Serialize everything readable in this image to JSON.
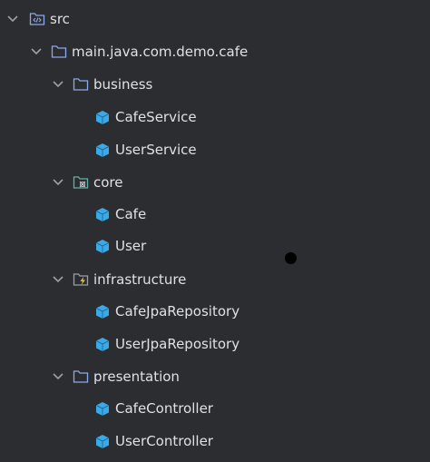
{
  "tree": {
    "src": {
      "label": "src",
      "icon": "source-root-icon"
    },
    "package": {
      "label": "main.java.com.demo.cafe",
      "icon": "package-folder-icon"
    },
    "business": {
      "label": "business",
      "icon": "folder-icon",
      "children": [
        {
          "label": "CafeService"
        },
        {
          "label": "UserService"
        }
      ]
    },
    "core": {
      "label": "core",
      "icon": "folder-core-icon",
      "children": [
        {
          "label": "Cafe"
        },
        {
          "label": "User"
        }
      ]
    },
    "infrastructure": {
      "label": "infrastructure",
      "icon": "folder-infrastructure-icon",
      "children": [
        {
          "label": "CafeJpaRepository"
        },
        {
          "label": "UserJpaRepository"
        }
      ]
    },
    "presentation": {
      "label": "presentation",
      "icon": "folder-icon",
      "children": [
        {
          "label": "CafeController"
        },
        {
          "label": "UserController"
        }
      ]
    }
  },
  "colors": {
    "background": "#2b2d30",
    "text": "#dfe1e5",
    "folder": "#8aa9e8",
    "class_icon": "#3aa9e8"
  }
}
